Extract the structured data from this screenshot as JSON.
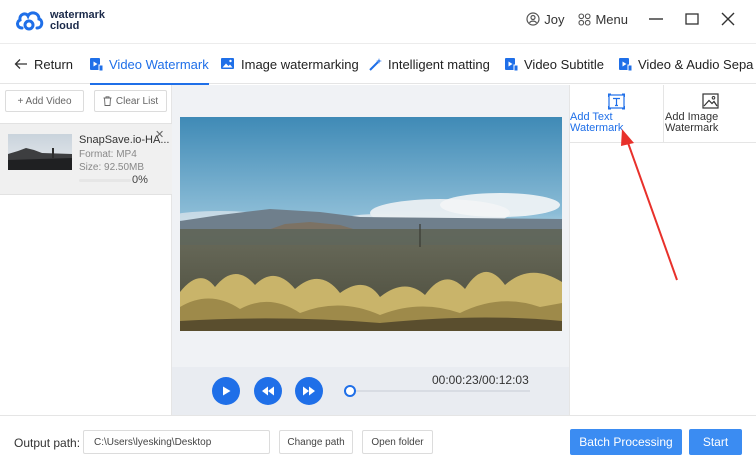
{
  "app": {
    "logo_line1": "watermark",
    "logo_line2": "cloud",
    "user": "Joy",
    "menu_label": "Menu",
    "brand_color": "#1f6fe8"
  },
  "tabs": {
    "return_label": "Return",
    "items": [
      {
        "label": "Video Watermark",
        "icon": "video-watermark-icon",
        "active": true
      },
      {
        "label": "Image watermarking",
        "icon": "image-icon"
      },
      {
        "label": "Intelligent matting",
        "icon": "magic-wand-icon"
      },
      {
        "label": "Video Subtitle",
        "icon": "video-subtitle-icon"
      },
      {
        "label": "Video & Audio Sepa",
        "icon": "video-audio-icon"
      }
    ]
  },
  "file_panel": {
    "add_video": "+ Add Video",
    "clear_list": "Clear List",
    "file": {
      "name": "SnapSave.io-HA...",
      "format": "Format:  MP4",
      "size": "Size:  92.50MB",
      "progress_text": "0%",
      "progress": 0
    }
  },
  "player": {
    "time": "00:00:23/00:12:03",
    "position_fraction": 0.03
  },
  "watermark_tools": {
    "add_text": "Add Text Watermark",
    "add_image": "Add Image Watermark"
  },
  "output": {
    "label": "Output path:",
    "path": "C:\\Users\\lyesking\\Desktop",
    "change_path": "Change path",
    "open_folder": "Open folder",
    "batch": "Batch Processing",
    "start": "Start"
  }
}
